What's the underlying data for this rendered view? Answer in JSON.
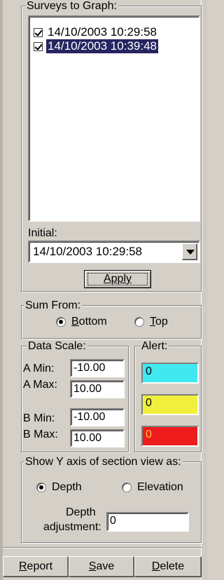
{
  "surveys": {
    "title": "Surveys to Graph:",
    "items": [
      {
        "label": "14/10/2003 10:29:58",
        "checked": true,
        "selected": false
      },
      {
        "label": "14/10/2003 10:39:48",
        "checked": true,
        "selected": true
      }
    ],
    "initial_label": "Initial:",
    "initial_value": "14/10/2003 10:29:58",
    "apply_label": "Apply"
  },
  "sum_from": {
    "title": "Sum From:",
    "bottom_label": "Bottom",
    "top_label": "Top",
    "selected": "Bottom"
  },
  "data_scale": {
    "title": "Data Scale:",
    "a_min_label": "A Min:",
    "a_min": "-10.00",
    "a_max_label": "A Max:",
    "a_max": "10.00",
    "b_min_label": "B Min:",
    "b_min": "-10.00",
    "b_max_label": "B Max:",
    "b_max": "10.00"
  },
  "alert": {
    "title": "Alert:",
    "levels": [
      {
        "value": "0",
        "color": "#42e8f0"
      },
      {
        "value": "0",
        "color": "#f0f03c"
      },
      {
        "value": "0",
        "color": "#ee1c1c"
      }
    ]
  },
  "y_axis": {
    "title": "Show Y axis of section view as:",
    "depth_label": "Depth",
    "elevation_label": "Elevation",
    "selected": "Depth",
    "adjustment_label_1": "Depth",
    "adjustment_label_2": "adjustment:",
    "adjustment_value": "0"
  },
  "footer": {
    "report_label": "Report",
    "save_label": "Save",
    "delete_label": "Delete"
  }
}
